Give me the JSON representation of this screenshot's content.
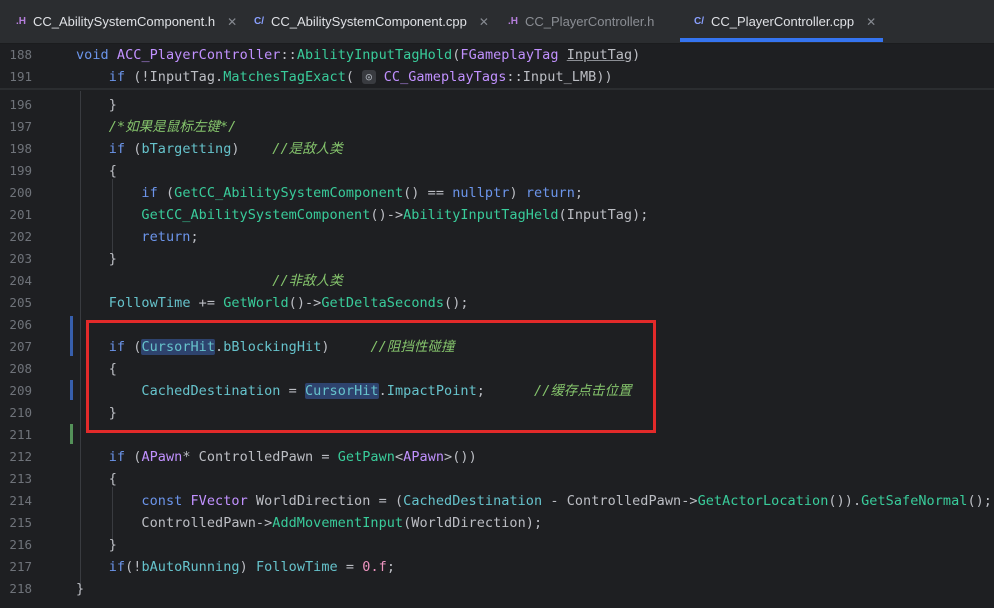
{
  "tabs": [
    {
      "icon": ".H",
      "label": "CC_AbilitySystemComponent.h",
      "close": "✕"
    },
    {
      "icon": "C/",
      "label": "CC_AbilitySystemComponent.cpp",
      "close": "✕"
    },
    {
      "icon": ".H",
      "label": "CC_PlayerController.h"
    },
    {
      "icon": "C/",
      "label": "CC_PlayerController.cpp",
      "close": "✕"
    }
  ],
  "lines": {
    "188": "188",
    "191": "191",
    "196": "196",
    "197": "197",
    "198": "198",
    "199": "199",
    "200": "200",
    "201": "201",
    "202": "202",
    "203": "203",
    "204": "204",
    "205": "205",
    "206": "206",
    "207": "207",
    "208": "208",
    "209": "209",
    "210": "210",
    "211": "211",
    "212": "212",
    "213": "213",
    "214": "214",
    "215": "215",
    "216": "216",
    "217": "217",
    "218": "218"
  },
  "comments": {
    "c197": "/*如果是鼠标左键*/",
    "c198": "//是敌人类",
    "c204": "//非敌人类",
    "c207": "//阻挡性碰撞",
    "c209": "//缓存点击位置"
  },
  "hint": "⊙"
}
